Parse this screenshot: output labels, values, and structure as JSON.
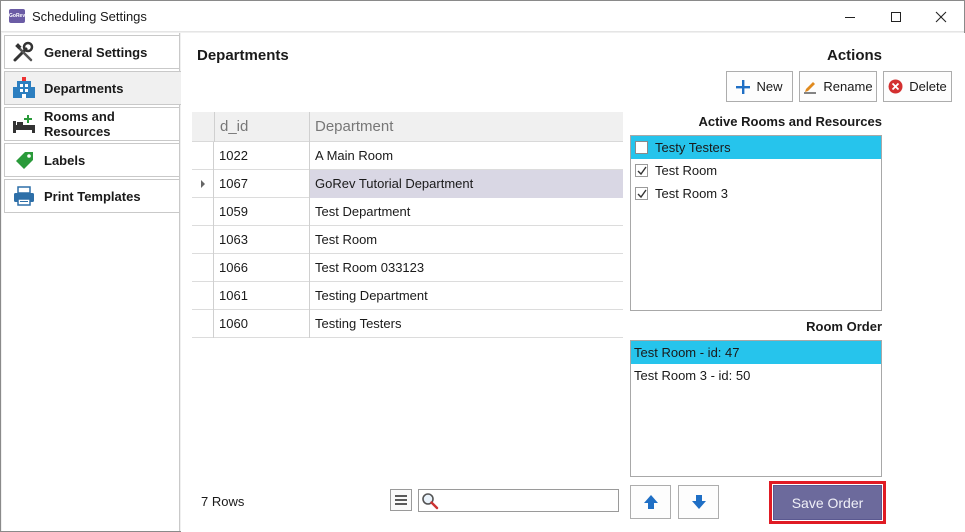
{
  "window": {
    "title": "Scheduling Settings",
    "app_icon_text": "GoRev"
  },
  "sidebar": {
    "items": [
      {
        "label": "General Settings",
        "icon": "wrench-screwdriver-icon"
      },
      {
        "label": "Departments",
        "icon": "building-icon",
        "active": true
      },
      {
        "label": "Rooms and Resources",
        "icon": "bed-plus-icon"
      },
      {
        "label": "Labels",
        "icon": "tag-icon"
      },
      {
        "label": "Print Templates",
        "icon": "printer-icon"
      }
    ]
  },
  "departments": {
    "title": "Departments",
    "columns": [
      "d_id",
      "Department"
    ],
    "rows": [
      {
        "id": "1022",
        "name": "A Main Room"
      },
      {
        "id": "1067",
        "name": "GoRev Tutorial Department",
        "selected": true
      },
      {
        "id": "1059",
        "name": "Test Department"
      },
      {
        "id": "1063",
        "name": "Test Room"
      },
      {
        "id": "1066",
        "name": "Test Room 033123"
      },
      {
        "id": "1061",
        "name": "Testing Department"
      },
      {
        "id": "1060",
        "name": "Testing Testers"
      }
    ],
    "row_count_text": "7 Rows",
    "search_placeholder": ""
  },
  "actions": {
    "title": "Actions",
    "new_label": "New",
    "rename_label": "Rename",
    "delete_label": "Delete"
  },
  "active_rooms": {
    "title": "Active Rooms and Resources",
    "items": [
      {
        "label": "Testy Testers",
        "checked": false,
        "highlighted": true
      },
      {
        "label": "Test Room",
        "checked": true,
        "highlighted": false
      },
      {
        "label": "Test Room 3",
        "checked": true,
        "highlighted": false
      }
    ]
  },
  "room_order": {
    "title": "Room Order",
    "items": [
      {
        "label": "Test Room - id: 47",
        "highlighted": true
      },
      {
        "label": "Test Room 3 - id: 50",
        "highlighted": false
      }
    ],
    "save_label": "Save Order"
  },
  "colors": {
    "highlight": "#26c4ec",
    "selected_row": "#d9d7e4",
    "save_button": "#6c6a9c",
    "save_outline": "#e01b24",
    "arrow_blue": "#1f6fc5"
  }
}
